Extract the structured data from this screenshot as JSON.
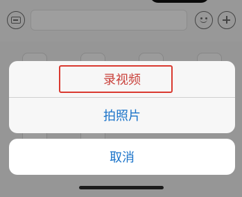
{
  "action_sheet": {
    "record_video_label": "录视频",
    "take_photo_label": "拍照片",
    "cancel_label": "取消"
  },
  "colors": {
    "action_text": "#1a73c9",
    "highlight": "#d9392f"
  },
  "icons": {
    "left": "chat-bubble-icon",
    "emoji": "smile-icon",
    "more": "plus-icon"
  }
}
